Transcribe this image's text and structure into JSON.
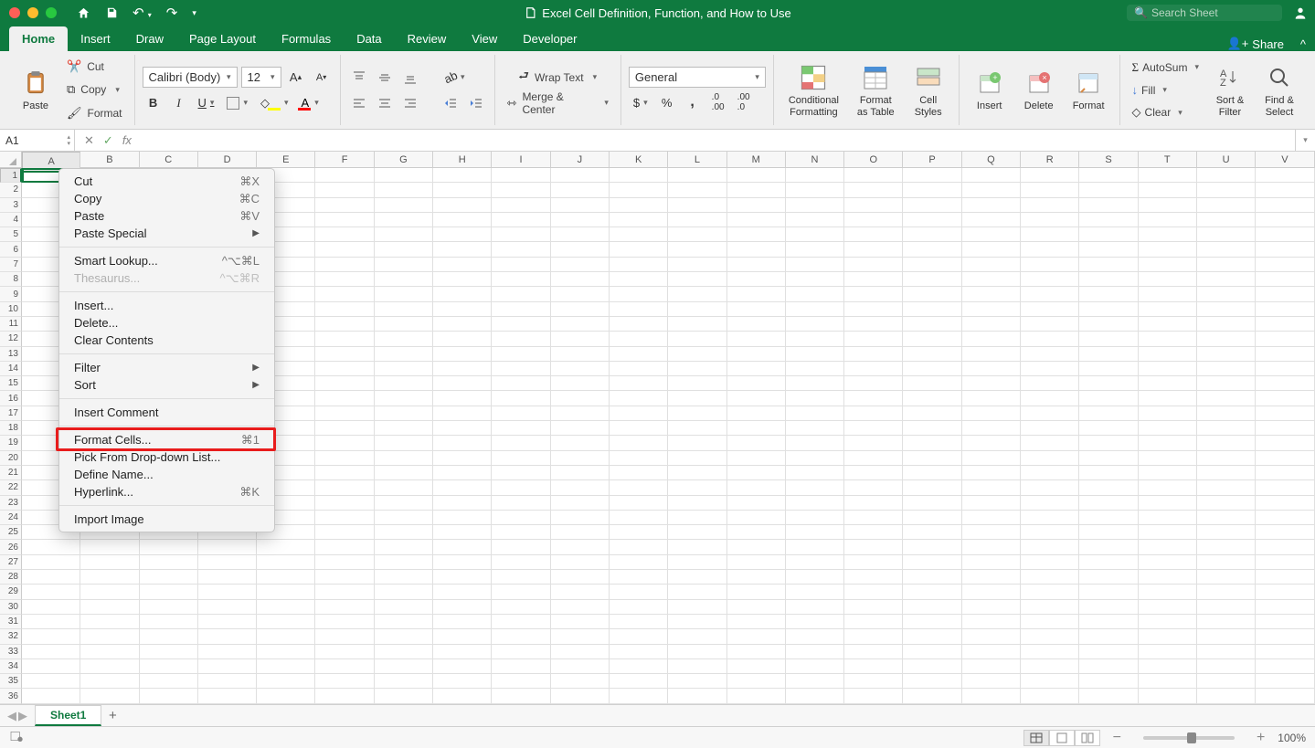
{
  "title": "Excel Cell Definition, Function, and How to Use",
  "search_placeholder": "Search Sheet",
  "share_label": "Share",
  "tabs": [
    "Home",
    "Insert",
    "Draw",
    "Page Layout",
    "Formulas",
    "Data",
    "Review",
    "View",
    "Developer"
  ],
  "active_tab": "Home",
  "clipboard": {
    "paste": "Paste",
    "cut": "Cut",
    "copy": "Copy",
    "format": "Format"
  },
  "font": {
    "name": "Calibri (Body)",
    "size": "12"
  },
  "alignment": {
    "wrap": "Wrap Text",
    "merge": "Merge & Center"
  },
  "number": {
    "format": "General"
  },
  "cells_group": {
    "cf": "Conditional\nFormatting",
    "fat": "Format\nas Table",
    "cs": "Cell\nStyles",
    "insert": "Insert",
    "delete": "Delete",
    "format": "Format"
  },
  "editing": {
    "autosum": "AutoSum",
    "fill": "Fill",
    "clear": "Clear",
    "sort": "Sort &\nFilter",
    "find": "Find &\nSelect"
  },
  "namebox": "A1",
  "fx_label": "fx",
  "columns": [
    "A",
    "B",
    "C",
    "D",
    "E",
    "F",
    "G",
    "H",
    "I",
    "J",
    "K",
    "L",
    "M",
    "N",
    "O",
    "P",
    "Q",
    "R",
    "S",
    "T",
    "U",
    "V"
  ],
  "row_count": 36,
  "context_menu": [
    {
      "type": "item",
      "label": "Cut",
      "shortcut": "⌘X"
    },
    {
      "type": "item",
      "label": "Copy",
      "shortcut": "⌘C"
    },
    {
      "type": "item",
      "label": "Paste",
      "shortcut": "⌘V"
    },
    {
      "type": "item",
      "label": "Paste Special",
      "submenu": true
    },
    {
      "type": "sep"
    },
    {
      "type": "item",
      "label": "Smart Lookup...",
      "shortcut": "^⌥⌘L"
    },
    {
      "type": "item",
      "label": "Thesaurus...",
      "shortcut": "^⌥⌘R",
      "disabled": true
    },
    {
      "type": "sep"
    },
    {
      "type": "item",
      "label": "Insert..."
    },
    {
      "type": "item",
      "label": "Delete..."
    },
    {
      "type": "item",
      "label": "Clear Contents"
    },
    {
      "type": "sep"
    },
    {
      "type": "item",
      "label": "Filter",
      "submenu": true
    },
    {
      "type": "item",
      "label": "Sort",
      "submenu": true
    },
    {
      "type": "sep"
    },
    {
      "type": "item",
      "label": "Insert Comment"
    },
    {
      "type": "sep"
    },
    {
      "type": "item",
      "label": "Format Cells...",
      "shortcut": "⌘1",
      "highlight": true
    },
    {
      "type": "item",
      "label": "Pick From Drop-down List..."
    },
    {
      "type": "item",
      "label": "Define Name..."
    },
    {
      "type": "item",
      "label": "Hyperlink...",
      "shortcut": "⌘K"
    },
    {
      "type": "sep"
    },
    {
      "type": "item",
      "label": "Import Image"
    }
  ],
  "sheet_name": "Sheet1",
  "zoom": "100%"
}
